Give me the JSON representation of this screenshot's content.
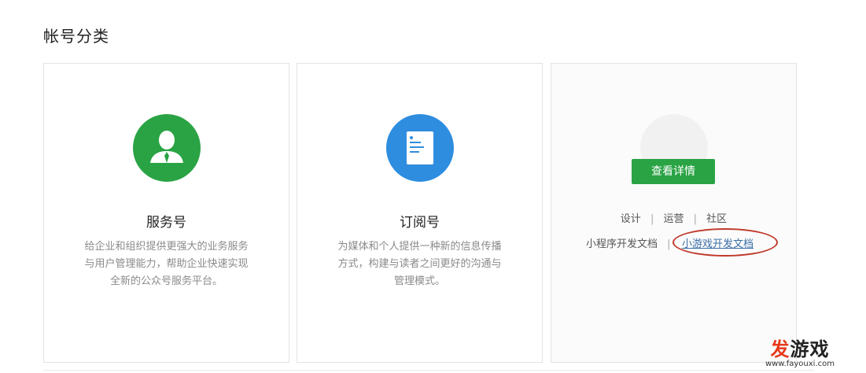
{
  "section": {
    "title": "帐号分类"
  },
  "cards": [
    {
      "title": "服务号",
      "desc_lines": [
        "给企业和组织提供更强大的业务服务",
        "与用户管理能力，帮助企业快速实现",
        "全新的公众号服务平台。"
      ],
      "icon": "person-icon",
      "color": "#2aa344"
    },
    {
      "title": "订阅号",
      "desc_lines": [
        "为媒体和个人提供一种新的信息传播",
        "方式，构建与读者之间更好的沟通与",
        "管理模式。"
      ],
      "icon": "document-icon",
      "color": "#2f8ddf"
    },
    {
      "button": "查看详情",
      "links": [
        "设计",
        "运营",
        "社区"
      ],
      "doc_links": [
        "小程序开发文档",
        "小游戏开发文档"
      ],
      "icon": "miniprogram-icon"
    }
  ],
  "watermark": {
    "text_a": "发",
    "text_b": "游戏",
    "url": "www.fayouxi.com"
  }
}
